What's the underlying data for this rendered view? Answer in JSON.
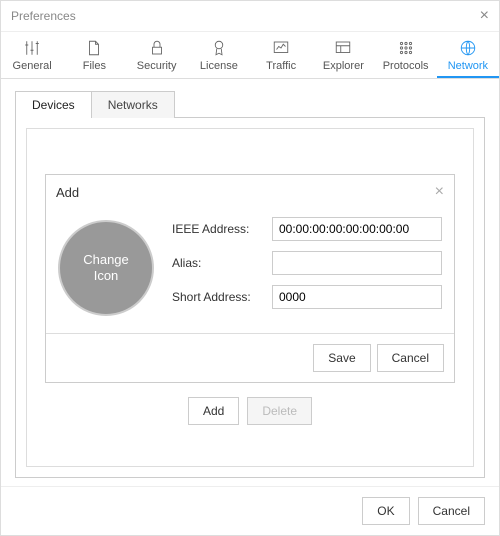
{
  "window": {
    "title": "Preferences"
  },
  "tabs": {
    "general": "General",
    "files": "Files",
    "security": "Security",
    "license": "License",
    "traffic": "Traffic",
    "explorer": "Explorer",
    "protocols": "Protocols",
    "network": "Network"
  },
  "subtabs": {
    "devices": "Devices",
    "networks": "Networks"
  },
  "add": {
    "title": "Add",
    "changeIcon": "Change\nIcon",
    "ieeeLabel": "IEEE Address:",
    "ieeeValue": "00:00:00:00:00:00:00:00",
    "aliasLabel": "Alias:",
    "aliasValue": "",
    "shortLabel": "Short Address:",
    "shortValue": "0000",
    "save": "Save",
    "cancel": "Cancel"
  },
  "panelButtons": {
    "add": "Add",
    "delete": "Delete"
  },
  "footer": {
    "ok": "OK",
    "cancel": "Cancel"
  }
}
